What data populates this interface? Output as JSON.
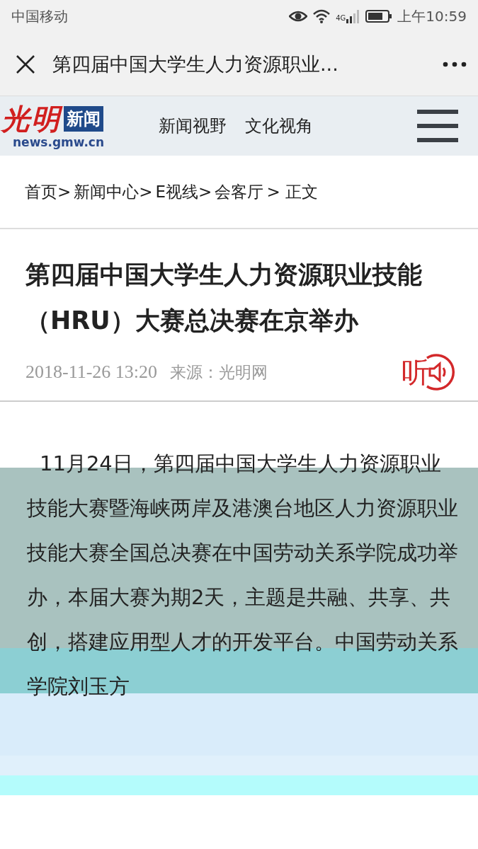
{
  "status_bar": {
    "carrier": "中国移动",
    "network": "4G",
    "time": "上午10:59"
  },
  "nav_bar": {
    "title": "第四届中国大学生人力资源职业..."
  },
  "site_header": {
    "logo_mark": "光明",
    "logo_badge": "新闻",
    "logo_domain": "news.gmw.cn",
    "links": [
      {
        "label": "新闻视野"
      },
      {
        "label": "文化视角"
      }
    ]
  },
  "breadcrumb": [
    "首页>",
    "新闻中心>",
    "E视线>",
    "会客厅",
    "> 正文"
  ],
  "article": {
    "title": "第四届中国大学生人力资源职业技能（HRU）大赛总决赛在京举办",
    "date": "2018-11-26 13:20",
    "source": "来源：光明网",
    "listen_label": "听",
    "body": "11月24日，第四届中国大学生人力资源职业技能大赛暨海峡两岸及港澳台地区人力资源职业技能大赛全国总决赛在中国劳动关系学院成功举办，本届大赛为期2天，主题是共融、共享、共创，搭建应用型人才的开发平台。中国劳动关系学院刘玉方"
  }
}
